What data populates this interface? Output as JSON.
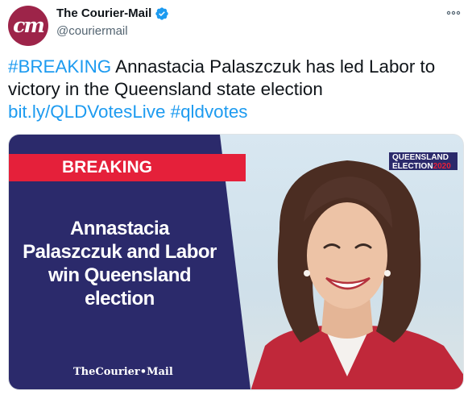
{
  "author": {
    "display_name": "The Courier-Mail",
    "handle": "@couriermail",
    "avatar_text": "cm",
    "verified": true
  },
  "tweet": {
    "hashtag_breaking": "#BREAKING",
    "body": " Annastacia Palaszczuk has led Labor to victory in the Queensland state election ",
    "link": "bit.ly/QLDVotesLive",
    "hashtag_votes": "#qldvotes"
  },
  "media": {
    "banner": "BREAKING",
    "headline_lines": [
      "Annastacia",
      "Palaszczuk and Labor",
      "win Queensland",
      "election"
    ],
    "badge_line1": "QUEENSLAND",
    "badge_line2": "ELECTION",
    "badge_year": "2020",
    "brand": "TheCourier•Mail"
  },
  "colors": {
    "brand": "#9d2449",
    "navy": "#2b2a6b",
    "red": "#e5203a",
    "link": "#1d9bf0",
    "verified": "#1d9bf0"
  },
  "icons": {
    "verified": "verified-badge-icon",
    "more": "more-options-icon"
  }
}
